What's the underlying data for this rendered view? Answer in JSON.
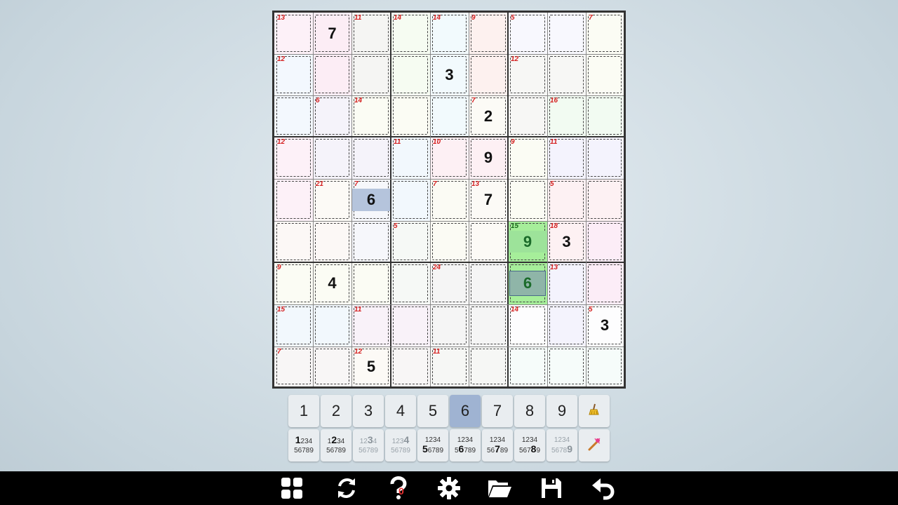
{
  "grid": {
    "cells": [
      [
        "",
        "7",
        "",
        "",
        "",
        "",
        "",
        "",
        ""
      ],
      [
        "",
        "",
        "",
        "",
        "3",
        "",
        "",
        "",
        ""
      ],
      [
        "",
        "",
        "",
        "",
        "",
        "2",
        "",
        "",
        ""
      ],
      [
        "",
        "",
        "",
        "",
        "",
        "9",
        "",
        "",
        ""
      ],
      [
        "",
        "",
        "6",
        "",
        "",
        "7",
        "",
        "",
        ""
      ],
      [
        "",
        "",
        "",
        "",
        "",
        "",
        "9",
        "3",
        ""
      ],
      [
        "",
        "4",
        "",
        "",
        "",
        "",
        "6",
        "",
        ""
      ],
      [
        "",
        "",
        "",
        "",
        "",
        "",
        "",
        "",
        "3"
      ],
      [
        "",
        "",
        "5",
        "",
        "",
        "",
        "",
        "",
        ""
      ]
    ],
    "cage_clues": [
      {
        "row": 0,
        "col": 0,
        "sum": "13"
      },
      {
        "row": 0,
        "col": 2,
        "sum": "11"
      },
      {
        "row": 0,
        "col": 3,
        "sum": "14"
      },
      {
        "row": 0,
        "col": 4,
        "sum": "14"
      },
      {
        "row": 0,
        "col": 5,
        "sum": "9"
      },
      {
        "row": 0,
        "col": 6,
        "sum": "5"
      },
      {
        "row": 0,
        "col": 8,
        "sum": "7"
      },
      {
        "row": 1,
        "col": 0,
        "sum": "12"
      },
      {
        "row": 1,
        "col": 6,
        "sum": "12"
      },
      {
        "row": 2,
        "col": 1,
        "sum": "6"
      },
      {
        "row": 2,
        "col": 2,
        "sum": "14"
      },
      {
        "row": 2,
        "col": 5,
        "sum": "7"
      },
      {
        "row": 2,
        "col": 7,
        "sum": "16"
      },
      {
        "row": 3,
        "col": 0,
        "sum": "12"
      },
      {
        "row": 3,
        "col": 3,
        "sum": "11"
      },
      {
        "row": 3,
        "col": 4,
        "sum": "10"
      },
      {
        "row": 3,
        "col": 6,
        "sum": "9"
      },
      {
        "row": 3,
        "col": 7,
        "sum": "11"
      },
      {
        "row": 4,
        "col": 1,
        "sum": "21"
      },
      {
        "row": 4,
        "col": 2,
        "sum": "7"
      },
      {
        "row": 4,
        "col": 4,
        "sum": "7"
      },
      {
        "row": 4,
        "col": 5,
        "sum": "13"
      },
      {
        "row": 4,
        "col": 7,
        "sum": "5"
      },
      {
        "row": 5,
        "col": 3,
        "sum": "5"
      },
      {
        "row": 5,
        "col": 6,
        "sum": "15"
      },
      {
        "row": 5,
        "col": 7,
        "sum": "18"
      },
      {
        "row": 6,
        "col": 0,
        "sum": "9"
      },
      {
        "row": 6,
        "col": 4,
        "sum": "24"
      },
      {
        "row": 6,
        "col": 7,
        "sum": "13"
      },
      {
        "row": 7,
        "col": 0,
        "sum": "15"
      },
      {
        "row": 7,
        "col": 2,
        "sum": "11"
      },
      {
        "row": 7,
        "col": 6,
        "sum": "14"
      },
      {
        "row": 7,
        "col": 8,
        "sum": "5"
      },
      {
        "row": 8,
        "col": 0,
        "sum": "7"
      },
      {
        "row": 8,
        "col": 2,
        "sum": "12"
      },
      {
        "row": 8,
        "col": 4,
        "sum": "11"
      }
    ]
  },
  "digit_buttons": [
    "1",
    "2",
    "3",
    "4",
    "5",
    "6",
    "7",
    "8",
    "9"
  ],
  "selected_digit": "6",
  "candidate_buttons": [
    {
      "top": "234",
      "bottom": "56789",
      "big": "1",
      "big_pos": "top",
      "dim": false
    },
    {
      "top": "2",
      "top_pre": "1",
      "top_post": "34",
      "bottom": "56789",
      "big": "2",
      "big_pos": "top",
      "dim": false
    },
    {
      "top_pre": "12",
      "top_post": "4",
      "bottom": "56789",
      "big": "3",
      "big_pos": "top",
      "dim": true
    },
    {
      "top_pre": "123",
      "top_post": "",
      "bottom": "56789",
      "big": "4",
      "big_pos": "top",
      "dim": true
    },
    {
      "top": "1234",
      "bottom_pre": "",
      "bottom_post": "6789",
      "big": "5",
      "big_pos": "bottom",
      "dim": false
    },
    {
      "top": "1234",
      "bottom_pre": "5",
      "bottom_post": "789",
      "big": "6",
      "big_pos": "bottom",
      "dim": false
    },
    {
      "top": "1234",
      "bottom_pre": "56",
      "bottom_post": "89",
      "big": "7",
      "big_pos": "bottom",
      "dim": false
    },
    {
      "top": "1234",
      "bottom_pre": "567",
      "bottom_post": "9",
      "big": "8",
      "big_pos": "bottom",
      "dim": false
    },
    {
      "top": "1234",
      "bottom_pre": "5678",
      "bottom_post": "",
      "big": "9",
      "big_pos": "bottom",
      "dim": true
    }
  ],
  "hint_count": "0",
  "icons": {
    "eraser": "broom-icon",
    "autofill": "magic-wand-icon",
    "menu": "grid-menu-icon",
    "restart": "refresh-icon",
    "hint": "question-icon",
    "settings": "gear-icon",
    "open": "folder-icon",
    "save": "save-icon",
    "undo": "undo-icon"
  },
  "colors": {
    "clue": "#d42020",
    "selected_digit_bg": "#9fb3d2",
    "highlight_green": "#a6ee9a",
    "given_selected_bg": "#b5c4dc"
  }
}
